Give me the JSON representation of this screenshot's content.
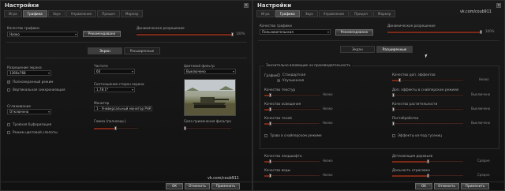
{
  "left": {
    "title": "Настройки",
    "tabs": [
      "Игра",
      "Графика",
      "Звук",
      "Управление",
      "Прицел",
      "Маркер"
    ],
    "quality_label": "Качество графики",
    "quality_value": "Низко",
    "recommended": "Рекомендовано",
    "dyn_res_label": "Динамическое разрешение",
    "dyn_res_value": "100%",
    "subtabs": [
      "Экран",
      "Расширенные"
    ],
    "resolution_label": "Разрешение экрана",
    "resolution_value": "1366x768",
    "frequency_label": "Частота",
    "frequency_value": "60",
    "aspect_label": "Соотношение сторон экрана",
    "aspect_value": "1,78:1*",
    "monitor_label": "Монитор",
    "monitor_value": "1 - Универсальный монитор PnP (",
    "gamma_label": "Гамма (полноэкр.)",
    "filter_label": "Цветовой фильтр",
    "filter_value": "Выключено",
    "filter_strength_label": "Сила применения фильтра",
    "fullscreen": "Полноэкранный режим",
    "vsync": "Вертикальная синхронизация",
    "aa_label": "Сглаживание",
    "aa_value": "Отключено",
    "triple_buffer": "Тройная буферизация",
    "color_depth": "Режим цветовой слепоты",
    "watermark": "vk.com/coub911",
    "ok": "OK",
    "cancel": "Отменить",
    "apply": "Применить"
  },
  "right": {
    "title": "Настройки",
    "tabs": [
      "Игра",
      "Графика",
      "Звук",
      "Управление",
      "Прицел",
      "Маркер"
    ],
    "quality_label": "Качество графики",
    "quality_value": "Пользовательская",
    "recommended": "Рекомендовано",
    "dyn_res_label": "Динамическое разрешение",
    "dyn_res_value": "100%",
    "subtabs": [
      "Экран",
      "Расширенные"
    ],
    "group_title": "Значительно влияющие на производительность",
    "graphics_label": "Графика",
    "standard": "Стандартная",
    "improved": "Улучшенная",
    "texture_label": "Качество текстур",
    "texture_value": "Низко",
    "lighting_label": "Качество освещения",
    "lighting_value": "Низко",
    "shadows_label": "Качество теней",
    "shadows_value": "Низко",
    "extra_effects_label": "Качество доп. эффектов",
    "extra_effects_value": "Низко",
    "sniper_effects_label": "Доп. эффекты в снайперском режиме",
    "sniper_effects_value": "Выключено",
    "vegetation_label": "Качество растительности",
    "vegetation_value": "Выключено",
    "postprocess_label": "Постобработка",
    "postprocess_value": "Выключено",
    "grass_sniper": "Трава в снайперском режиме",
    "track_effects": "Эффекты из-под гусениц",
    "landscape_label": "Качество ландшафта",
    "landscape_value": "Низко",
    "water_label": "Качество воды",
    "water_value": "Низко",
    "detail_label": "Детализация деревьев",
    "detail_value": "Средне",
    "draw_distance_label": "Дальность отрисовки",
    "draw_distance_value": "Средне",
    "watermark": "vk.com/coub911",
    "ok": "OK",
    "cancel": "Отменить",
    "apply": "Применить"
  },
  "colors": {
    "accent": "#7a2a18",
    "panel": "#161616",
    "text": "#a9a9a9"
  }
}
